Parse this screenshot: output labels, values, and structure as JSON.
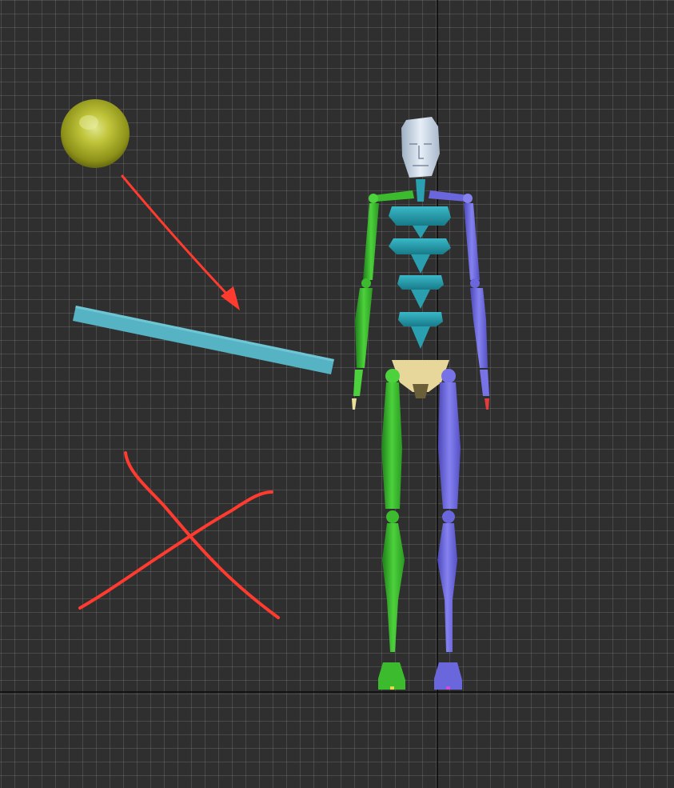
{
  "viewport": {
    "type": "3d-perspective-grid"
  },
  "colors": {
    "background": "#2f2f2f",
    "grid": "#5a5a5a",
    "axis": "#0a0a0a",
    "sphere": "#b0b52a",
    "box": "#55b3c4",
    "annotation": "#ff3b30",
    "skeleton_left": "#3dbb2e",
    "skeleton_right": "#6a66dc",
    "spine": "#2aa0b0",
    "pelvis": "#e8d79a",
    "head": "#c9d6e6"
  },
  "objects": {
    "sphere": {
      "name": "sphere"
    },
    "box": {
      "name": "box"
    },
    "annotations": [
      {
        "name": "red-arrow"
      },
      {
        "name": "red-x-mark"
      }
    ],
    "skeleton": {
      "name": "biped-skeleton"
    }
  },
  "icons": [
    "sphere-icon",
    "box-icon",
    "arrow-icon",
    "x-mark-icon",
    "skeleton-icon"
  ]
}
